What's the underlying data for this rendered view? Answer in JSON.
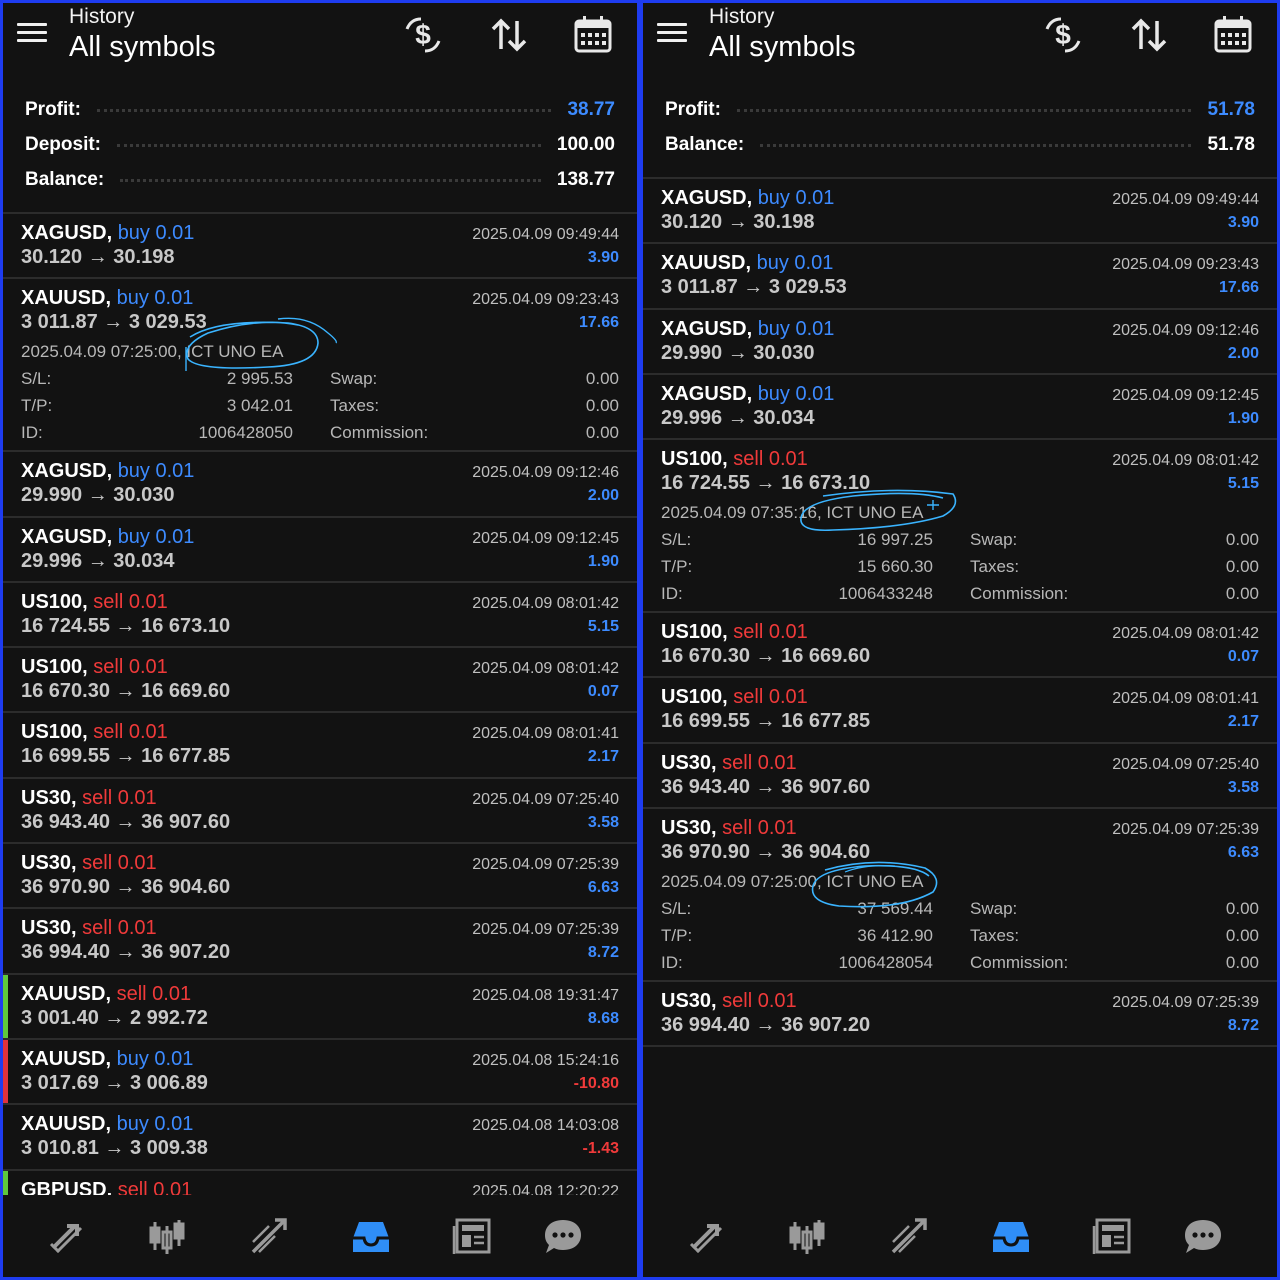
{
  "left": {
    "header": {
      "subtitle": "History",
      "title": "All symbols"
    },
    "summary": [
      {
        "label": "Profit:",
        "value": "38.77",
        "highlight": true
      },
      {
        "label": "Deposit:",
        "value": "100.00",
        "highlight": false
      },
      {
        "label": "Balance:",
        "value": "138.77",
        "highlight": false
      }
    ],
    "trades": [
      {
        "symbol": "XAGUSD,",
        "side": "buy",
        "lots": "0.01",
        "prices": "30.120 → 30.198",
        "time": "2025.04.09 09:49:44",
        "profit": "3.90"
      },
      {
        "symbol": "XAUUSD,",
        "side": "buy",
        "lots": "0.01",
        "prices": "3 011.87 → 3 029.53",
        "time": "2025.04.09 09:23:43",
        "profit": "17.66",
        "detail": {
          "open": "2025.04.09 07:25:00, ICT UNO EA",
          "sl_label": "S/L:",
          "sl": "2 995.53",
          "tp_label": "T/P:",
          "tp": "3 042.01",
          "id_label": "ID:",
          "id": "1006428050",
          "swap_label": "Swap:",
          "swap": "0.00",
          "taxes_label": "Taxes:",
          "taxes": "0.00",
          "commission_label": "Commission:",
          "commission": "0.00"
        }
      },
      {
        "symbol": "XAGUSD,",
        "side": "buy",
        "lots": "0.01",
        "prices": "29.990 → 30.030",
        "time": "2025.04.09 09:12:46",
        "profit": "2.00"
      },
      {
        "symbol": "XAGUSD,",
        "side": "buy",
        "lots": "0.01",
        "prices": "29.996 → 30.034",
        "time": "2025.04.09 09:12:45",
        "profit": "1.90"
      },
      {
        "symbol": "US100,",
        "side": "sell",
        "lots": "0.01",
        "prices": "16 724.55 → 16 673.10",
        "time": "2025.04.09 08:01:42",
        "profit": "5.15"
      },
      {
        "symbol": "US100,",
        "side": "sell",
        "lots": "0.01",
        "prices": "16 670.30 → 16 669.60",
        "time": "2025.04.09 08:01:42",
        "profit": "0.07"
      },
      {
        "symbol": "US100,",
        "side": "sell",
        "lots": "0.01",
        "prices": "16 699.55 → 16 677.85",
        "time": "2025.04.09 08:01:41",
        "profit": "2.17"
      },
      {
        "symbol": "US30,",
        "side": "sell",
        "lots": "0.01",
        "prices": "36 943.40 → 36 907.60",
        "time": "2025.04.09 07:25:40",
        "profit": "3.58"
      },
      {
        "symbol": "US30,",
        "side": "sell",
        "lots": "0.01",
        "prices": "36 970.90 → 36 904.60",
        "time": "2025.04.09 07:25:39",
        "profit": "6.63"
      },
      {
        "symbol": "US30,",
        "side": "sell",
        "lots": "0.01",
        "prices": "36 994.40 → 36 907.20",
        "time": "2025.04.09 07:25:39",
        "profit": "8.72"
      },
      {
        "symbol": "XAUUSD,",
        "side": "sell",
        "lots": "0.01",
        "prices": "3 001.40 → 2 992.72",
        "time": "2025.04.08 19:31:47",
        "profit": "8.68",
        "edge": "#5fc83c"
      },
      {
        "symbol": "XAUUSD,",
        "side": "buy",
        "lots": "0.01",
        "prices": "3 017.69 → 3 006.89",
        "time": "2025.04.08 15:24:16",
        "profit": "-10.80",
        "negative": true,
        "edge": "#e0323c"
      },
      {
        "symbol": "XAUUSD,",
        "side": "buy",
        "lots": "0.01",
        "prices": "3 010.81 → 3 009.38",
        "time": "2025.04.08 14:03:08",
        "profit": "-1.43",
        "negative": true
      },
      {
        "symbol": "GBPUSD,",
        "side": "sell",
        "lots": "0.01",
        "prices": "",
        "time": "2025.04.08 12:20:22",
        "profit": "",
        "edge": "#5fc83c"
      }
    ]
  },
  "right": {
    "header": {
      "subtitle": "History",
      "title": "All symbols"
    },
    "summary": [
      {
        "label": "Profit:",
        "value": "51.78",
        "highlight": true
      },
      {
        "label": "Balance:",
        "value": "51.78",
        "highlight": false
      }
    ],
    "trades": [
      {
        "symbol": "XAGUSD,",
        "side": "buy",
        "lots": "0.01",
        "prices": "30.120 → 30.198",
        "time": "2025.04.09 09:49:44",
        "profit": "3.90"
      },
      {
        "symbol": "XAUUSD,",
        "side": "buy",
        "lots": "0.01",
        "prices": "3 011.87 → 3 029.53",
        "time": "2025.04.09 09:23:43",
        "profit": "17.66"
      },
      {
        "symbol": "XAGUSD,",
        "side": "buy",
        "lots": "0.01",
        "prices": "29.990 → 30.030",
        "time": "2025.04.09 09:12:46",
        "profit": "2.00"
      },
      {
        "symbol": "XAGUSD,",
        "side": "buy",
        "lots": "0.01",
        "prices": "29.996 → 30.034",
        "time": "2025.04.09 09:12:45",
        "profit": "1.90"
      },
      {
        "symbol": "US100,",
        "side": "sell",
        "lots": "0.01",
        "prices": "16 724.55 → 16 673.10",
        "time": "2025.04.09 08:01:42",
        "profit": "5.15",
        "detail": {
          "open": "2025.04.09 07:35:16, ICT UNO EA",
          "sl_label": "S/L:",
          "sl": "16 997.25",
          "tp_label": "T/P:",
          "tp": "15 660.30",
          "id_label": "ID:",
          "id": "1006433248",
          "swap_label": "Swap:",
          "swap": "0.00",
          "taxes_label": "Taxes:",
          "taxes": "0.00",
          "commission_label": "Commission:",
          "commission": "0.00"
        }
      },
      {
        "symbol": "US100,",
        "side": "sell",
        "lots": "0.01",
        "prices": "16 670.30 → 16 669.60",
        "time": "2025.04.09 08:01:42",
        "profit": "0.07"
      },
      {
        "symbol": "US100,",
        "side": "sell",
        "lots": "0.01",
        "prices": "16 699.55 → 16 677.85",
        "time": "2025.04.09 08:01:41",
        "profit": "2.17"
      },
      {
        "symbol": "US30,",
        "side": "sell",
        "lots": "0.01",
        "prices": "36 943.40 → 36 907.60",
        "time": "2025.04.09 07:25:40",
        "profit": "3.58"
      },
      {
        "symbol": "US30,",
        "side": "sell",
        "lots": "0.01",
        "prices": "36 970.90 → 36 904.60",
        "time": "2025.04.09 07:25:39",
        "profit": "6.63",
        "detail": {
          "open": "2025.04.09 07:25:00, ICT UNO EA",
          "sl_label": "S/L:",
          "sl": "37 569.44",
          "tp_label": "T/P:",
          "tp": "36 412.90",
          "id_label": "ID:",
          "id": "1006428054",
          "swap_label": "Swap:",
          "swap": "0.00",
          "taxes_label": "Taxes:",
          "taxes": "0.00",
          "commission_label": "Commission:",
          "commission": "0.00"
        }
      },
      {
        "symbol": "US30,",
        "side": "sell",
        "lots": "0.01",
        "prices": "36 994.40 → 36 907.20",
        "time": "2025.04.09 07:25:39",
        "profit": "8.72"
      }
    ]
  },
  "icons": {
    "top": [
      "currency-exchange-icon",
      "sort-icon",
      "calendar-icon"
    ],
    "nav": [
      "quotes-icon",
      "chart-icon",
      "trade-icon",
      "history-icon",
      "news-icon",
      "chat-icon"
    ]
  },
  "colors": {
    "background": "#121212",
    "frame": "#1e3cf0",
    "buy": "#3d8bff",
    "sell": "#f03a3a",
    "profit": "#3d8bff",
    "loss": "#f03a3a",
    "active_nav": "#2f8ef7",
    "annotation": "#3ab4ff"
  }
}
